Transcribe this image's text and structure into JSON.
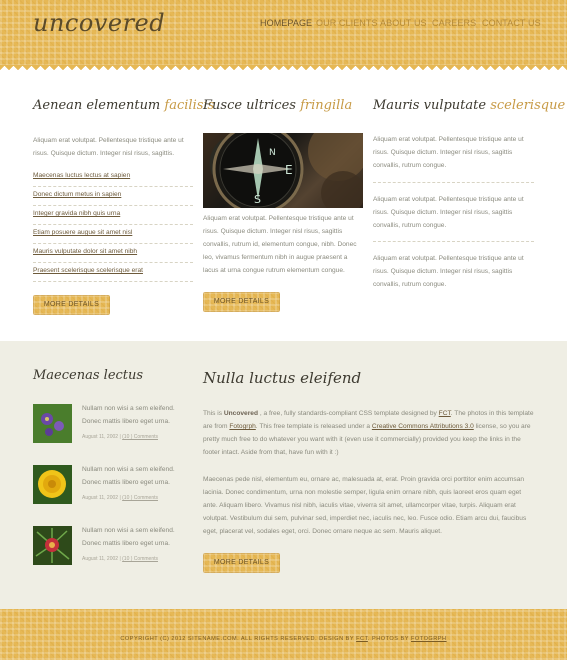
{
  "header": {
    "logo": "uncovered",
    "nav": [
      {
        "label": "HOMEPAGE",
        "active": true
      },
      {
        "label": "OUR CLIENTS",
        "active": false
      },
      {
        "label": "ABOUT US",
        "active": false
      },
      {
        "label": "CAREERS",
        "active": false
      },
      {
        "label": "CONTACT US",
        "active": false
      }
    ]
  },
  "col1": {
    "title_main": "Aenean elementum",
    "title_hl": "facilisis",
    "text": "Aliquam erat volutpat. Pellentesque tristique ante ut risus. Quisque dictum. Integer nisl risus, sagittis.",
    "links": [
      "Maecenas luctus lectus at sapien",
      "Donec dictum metus in sapien",
      "Integer gravida nibh quis urna",
      "Etiam posuere augue sit amet nisl",
      "Mauris vulputate dolor sit amet nibh",
      "Praesent scelerisque scelerisque erat"
    ],
    "button": "MORE DETAILS"
  },
  "col2": {
    "title_main": "Fusce ultrices",
    "title_hl": "fringilla",
    "text": "Aliquam erat volutpat. Pellentesque tristique ante ut risus. Quisque dictum. Integer nisl risus, sagittis convallis, rutrum id, elementum congue, nibh. Donec leo, vivamus fermentum nibh in augue praesent a lacus at urna congue rutrum elementum congue.",
    "button": "MORE DETAILS"
  },
  "col3": {
    "title_main": "Mauris vulputate",
    "title_hl": "scelerisque",
    "items": [
      "Aliquam erat volutpat. Pellentesque tristique ante ut risus. Quisque dictum. Integer nisl risus, sagittis convallis, rutrum congue.",
      "Aliquam erat volutpat. Pellentesque tristique ante ut risus. Quisque dictum. Integer nisl risus, sagittis convallis, rutrum congue.",
      "Aliquam erat volutpat. Pellentesque tristique ante ut risus. Quisque dictum. Integer nisl risus, sagittis convallis, rutrum congue."
    ]
  },
  "sidebar": {
    "title": "Maecenas lectus",
    "posts": [
      {
        "text": "Nullam non wisi a sem eleifend. Donec mattis libero eget urna.",
        "date": "August 11, 2002",
        "comments": "(10 ) Comments",
        "icon": "purple-flower-icon"
      },
      {
        "text": "Nullam non wisi a sem eleifend. Donec mattis libero eget urna.",
        "date": "August 11, 2002",
        "comments": "(10 ) Comments",
        "icon": "yellow-flower-icon"
      },
      {
        "text": "Nullam non wisi a sem eleifend. Donec mattis libero eget urna.",
        "date": "August 11, 2002",
        "comments": "(10 ) Comments",
        "icon": "red-thistle-icon"
      }
    ]
  },
  "main": {
    "title": "Nulla luctus eleifend",
    "p1_a": "This is ",
    "p1_brand": "Uncovered",
    "p1_b": " , a free, fully standards-compliant CSS template designed by ",
    "p1_link1": "FCT",
    "p1_c": ". The photos in this template are from ",
    "p1_link2": "Fotogrph",
    "p1_d": ". This free template is released under a ",
    "p1_link3": "Creative Commons Attributions 3.0",
    "p1_e": " license, so you are pretty much free to do whatever you want with it (even use it commercially) provided you keep the links in the footer intact. Aside from that, have fun with it :)",
    "p2": "Maecenas pede nisl, elementum eu, ornare ac, malesuada at, erat. Proin gravida orci porttitor enim accumsan lacinia. Donec condimentum, urna non molestie semper, ligula enim ornare nibh, quis laoreet eros quam eget ante. Aliquam libero. Vivamus nisl nibh, iaculis vitae, viverra sit amet, ullamcorper vitae, turpis. Aliquam erat volutpat. Vestibulum dui sem, pulvinar sed, imperdiet nec, iaculis nec, leo. Fusce odio. Etiam arcu dui, faucibus eget, placerat vel, sodales eget, orci. Donec ornare neque ac sem. Mauris aliquet.",
    "button": "MORE DETAILS"
  },
  "footer": {
    "copyright": "COPYRIGHT (C) 2012 SITENAME.COM. ALL RIGHTS RESERVED. DESIGN BY ",
    "design_link": "FCT",
    "photos_text": ". PHOTOS BY ",
    "photos_link": "FOTOGRPH"
  },
  "colors": {
    "accent": "#e6b855",
    "highlight": "#c79a45",
    "band": "#efeee4"
  }
}
